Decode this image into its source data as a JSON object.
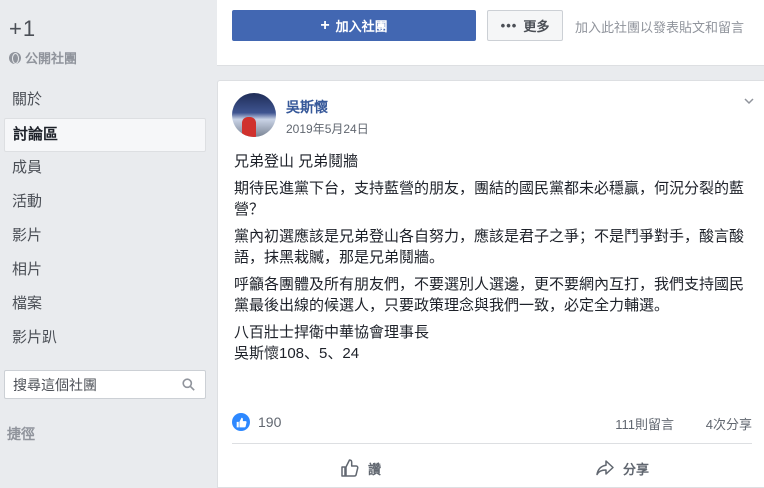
{
  "group": {
    "title": "+1",
    "privacy": "公開社團"
  },
  "sidebar": {
    "items": [
      {
        "label": "關於"
      },
      {
        "label": "討論區"
      },
      {
        "label": "成員"
      },
      {
        "label": "活動"
      },
      {
        "label": "影片"
      },
      {
        "label": "相片"
      },
      {
        "label": "檔案"
      },
      {
        "label": "影片趴"
      }
    ],
    "active_index": 1,
    "search_placeholder": "搜尋這個社團",
    "shortcuts_label": "捷徑"
  },
  "topbar": {
    "join_label": "加入社團",
    "more_label": "更多",
    "hint": "加入此社團以發表貼文和留言"
  },
  "post": {
    "author": "吳斯懷",
    "date": "2019年5月24日",
    "paragraphs": [
      "兄弟登山 兄弟鬩牆",
      "期待民進黨下台，支持藍營的朋友，團結的國民黨都未必穩贏，何況分裂的藍營？",
      "黨內初選應該是兄弟登山各自努力，應該是君子之爭；不是鬥爭對手，酸言酸語，抹黑栽贓，那是兄弟鬩牆。",
      "呼籲各團體及所有朋友們，不要選別人選邊，更不要網內互打，我們支持國民黨最後出線的候選人，只要政策理念與我們一致，必定全力輔選。"
    ],
    "signature_line1": "八百壯士捍衛中華協會理事長",
    "signature_line2": "吳斯懷108、5、24",
    "like_count": "190",
    "comments_count": "111則留言",
    "shares_count": "4次分享",
    "like_label": "讚",
    "share_label": "分享"
  },
  "colors": {
    "brand": "#4267b2",
    "link": "#365899",
    "background": "#e9ebee"
  }
}
